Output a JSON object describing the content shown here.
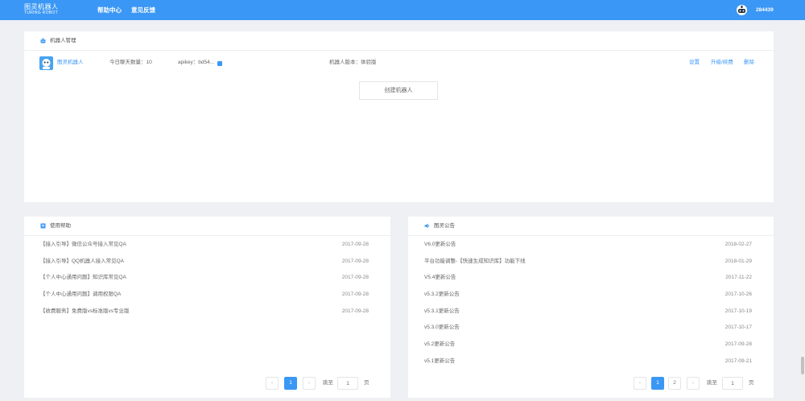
{
  "header": {
    "logo_line1": "图灵机器人",
    "logo_line2": "TURING ROBOT",
    "nav": [
      "帮助中心",
      "意见反馈"
    ],
    "user_id": "284439"
  },
  "robot_panel": {
    "title": "机器人管理",
    "robot": {
      "name": "图灵机器人",
      "chat_count": "今日聊天数量：10",
      "apikey": "apikey：bd54...",
      "version": "机器人版本：体验版",
      "actions": [
        "设置",
        "升级/续费",
        "删除"
      ]
    },
    "create_label": "创建机器人"
  },
  "help_panel": {
    "title": "使用帮助",
    "items": [
      {
        "text": "【接入引导】微信公众号接入常见QA",
        "date": "2017-09-28"
      },
      {
        "text": "【接入引导】QQ机器人接入常见QA",
        "date": "2017-09-28"
      },
      {
        "text": "【个人中心通用问题】知识库常见QA",
        "date": "2017-09-28"
      },
      {
        "text": "【个人中心通用问题】调用权限QA",
        "date": "2017-09-28"
      },
      {
        "text": "【收费服务】免费版vs标准版vs专业版",
        "date": "2017-09-28"
      }
    ],
    "pagination": {
      "prev": "‹",
      "pages": [
        "1"
      ],
      "next": "›",
      "goto_label": "跳至",
      "page_value": "1",
      "page_unit": "页"
    }
  },
  "notice_panel": {
    "title": "图灵公告",
    "items": [
      {
        "text": "V6.0更新公告",
        "date": "2018-02-27"
      },
      {
        "text": "平台功能调整-【快速生成知识库】功能下线",
        "date": "2018-01-29"
      },
      {
        "text": "V5.4更新公告",
        "date": "2017-11-22"
      },
      {
        "text": "v5.3.2更新公告",
        "date": "2017-10-26"
      },
      {
        "text": "v5.3.1更新公告",
        "date": "2017-10-19"
      },
      {
        "text": "v5.3.0更新公告",
        "date": "2017-10-17"
      },
      {
        "text": "v5.2更新公告",
        "date": "2017-09-28"
      },
      {
        "text": "v5.1更新公告",
        "date": "2017-09-21"
      }
    ],
    "pagination": {
      "prev": "‹",
      "pages": [
        "1",
        "2"
      ],
      "next": "›",
      "goto_label": "跳至",
      "page_value": "1",
      "page_unit": "页"
    }
  },
  "colors": {
    "accent": "#3b97f5",
    "background": "#eef0f3"
  },
  "icons": [
    "robot-manage-icon",
    "help-icon",
    "announcement-icon",
    "user-avatar-icon",
    "copy-icon"
  ]
}
